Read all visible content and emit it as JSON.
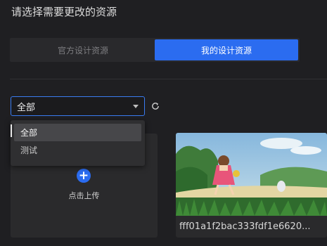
{
  "header": {
    "title": "请选择需要更改的资源"
  },
  "tabs": [
    {
      "label": "官方设计资源",
      "active": false
    },
    {
      "label": "我的设计资源",
      "active": true
    }
  ],
  "filter": {
    "selected": "全部",
    "options": [
      "全部",
      "测试"
    ],
    "refresh_icon": "refresh-icon"
  },
  "upload": {
    "label": "点击上传",
    "icon": "plus-icon"
  },
  "resources": [
    {
      "caption": "fff01a1f2bac333fdf1e6620..."
    }
  ],
  "colors": {
    "accent": "#2b6cf0",
    "background": "#1f1f22",
    "card": "#2a2a2c"
  }
}
